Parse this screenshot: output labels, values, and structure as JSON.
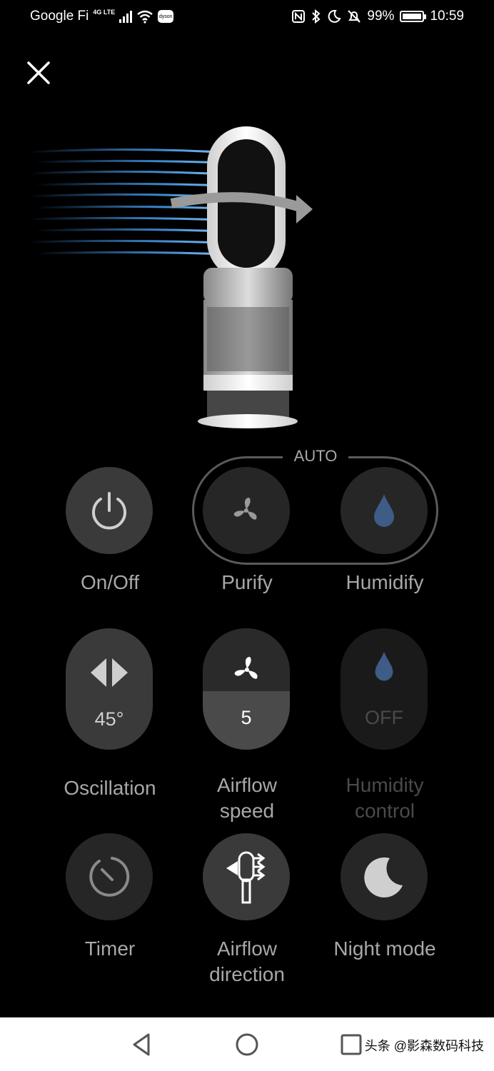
{
  "status_bar": {
    "carrier": "Google Fi",
    "network": "4G LTE",
    "app_badge": "dyson",
    "battery": "99%",
    "time": "10:59"
  },
  "modes": {
    "auto_label": "AUTO"
  },
  "controls": {
    "on_off": "On/Off",
    "purify": "Purify",
    "humidify": "Humidify",
    "oscillation": "Oscillation",
    "oscillation_value": "45°",
    "airflow_speed_line1": "Airflow",
    "airflow_speed_line2": "speed",
    "airflow_speed_value": "5",
    "humidity_control_line1": "Humidity",
    "humidity_control_line2": "control",
    "humidity_control_value": "OFF",
    "timer": "Timer",
    "airflow_direction_line1": "Airflow",
    "airflow_direction_line2": "direction",
    "night_mode": "Night mode"
  },
  "nav_bar": {
    "watermark": "头条 @影森数码科技"
  },
  "colors": {
    "background": "#000000",
    "button": "#3a3a3a",
    "button_dark": "#262626",
    "label": "#a8a8a8",
    "water_blue": "#3d5c86",
    "airflow_blue": "#4aa8ff"
  }
}
